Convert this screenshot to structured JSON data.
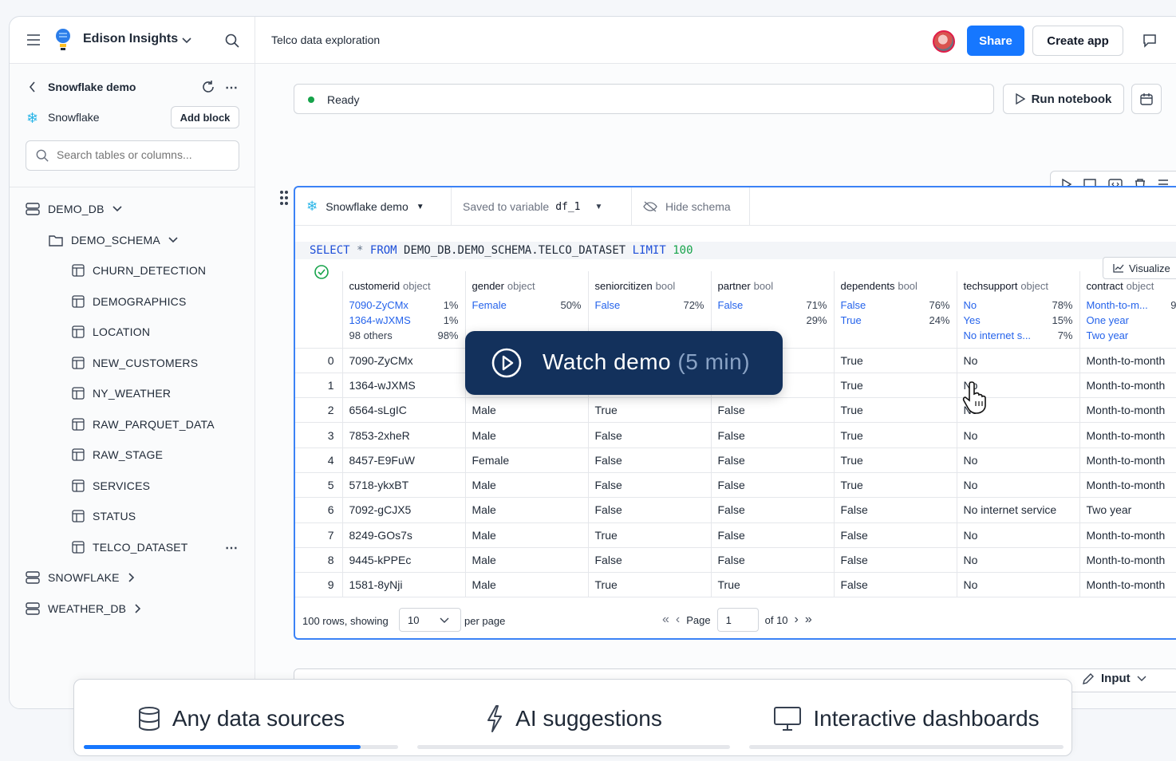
{
  "topbar": {
    "brand": "Edison Insights",
    "doc_title": "Telco data exploration",
    "share": "Share",
    "create_app": "Create app"
  },
  "sidebar": {
    "title": "Snowflake demo",
    "connection": "Snowflake",
    "add_block": "Add block",
    "search_placeholder": "Search tables or columns...",
    "databases": [
      "DEMO_DB",
      "SNOWFLAKE",
      "WEATHER_DB"
    ],
    "schema": "DEMO_SCHEMA",
    "tables": [
      "CHURN_DETECTION",
      "DEMOGRAPHICS",
      "LOCATION",
      "NEW_CUSTOMERS",
      "NY_WEATHER",
      "RAW_PARQUET_DATA",
      "RAW_STAGE",
      "SERVICES",
      "STATUS",
      "TELCO_DATASET"
    ]
  },
  "notebook": {
    "status": "Ready",
    "run": "Run notebook"
  },
  "cell": {
    "source": "Snowflake demo",
    "saved_label": "Saved to variable",
    "variable": "df_1",
    "hide_schema": "Hide schema",
    "sql": {
      "k1": "SELECT",
      "star": "*",
      "k2": "FROM",
      "table": "DEMO_DB.DEMO_SCHEMA.TELCO_DATASET",
      "k3": "LIMIT",
      "n": "100"
    },
    "visualize": "Visualize",
    "columns": [
      {
        "name": "customerid",
        "type": "object",
        "stats": [
          [
            "7090-ZyCMx",
            "1%"
          ],
          [
            "1364-wJXMS",
            "1%"
          ],
          [
            "98 others",
            "98%"
          ]
        ]
      },
      {
        "name": "gender",
        "type": "object",
        "stats": [
          [
            "",
            ""
          ],
          [
            "Female",
            "50%"
          ],
          [
            "",
            ""
          ]
        ]
      },
      {
        "name": "seniorcitizen",
        "type": "bool",
        "stats": [
          [
            "",
            ""
          ],
          [
            "False",
            "72%"
          ],
          [
            "",
            ""
          ]
        ]
      },
      {
        "name": "partner",
        "type": "bool",
        "stats": [
          [
            "",
            ""
          ],
          [
            "False",
            "71%"
          ],
          [
            "",
            "29%"
          ]
        ]
      },
      {
        "name": "dependents",
        "type": "bool",
        "stats": [
          [
            "",
            ""
          ],
          [
            "False",
            "76%"
          ],
          [
            "True",
            "24%"
          ]
        ]
      },
      {
        "name": "techsupport",
        "type": "object",
        "stats": [
          [
            "No",
            "78%"
          ],
          [
            "Yes",
            "15%"
          ],
          [
            "No internet s...",
            "7%"
          ]
        ]
      },
      {
        "name": "contract",
        "type": "object",
        "stats": [
          [
            "Month-to-m...",
            "9"
          ],
          [
            "One year",
            ""
          ],
          [
            "Two year",
            ""
          ]
        ]
      }
    ],
    "rows": [
      [
        "0",
        "7090-ZyCMx",
        "",
        "",
        "",
        "True",
        "No",
        "Month-to-month"
      ],
      [
        "1",
        "1364-wJXMS",
        "",
        "",
        "",
        "True",
        "No",
        "Month-to-month"
      ],
      [
        "2",
        "6564-sLgIC",
        "Male",
        "True",
        "False",
        "True",
        "No",
        "Month-to-month"
      ],
      [
        "3",
        "7853-2xheR",
        "Male",
        "False",
        "False",
        "True",
        "No",
        "Month-to-month"
      ],
      [
        "4",
        "8457-E9FuW",
        "Female",
        "False",
        "False",
        "True",
        "No",
        "Month-to-month"
      ],
      [
        "5",
        "5718-ykxBT",
        "Male",
        "False",
        "False",
        "True",
        "No",
        "Month-to-month"
      ],
      [
        "6",
        "7092-gCJX5",
        "Male",
        "False",
        "False",
        "False",
        "No internet service",
        "Two year"
      ],
      [
        "7",
        "8249-GOs7s",
        "Male",
        "True",
        "False",
        "False",
        "No",
        "Month-to-month"
      ],
      [
        "8",
        "9445-kPPEc",
        "Male",
        "False",
        "False",
        "False",
        "No",
        "Month-to-month"
      ],
      [
        "9",
        "1581-8yNji",
        "Male",
        "True",
        "True",
        "False",
        "No",
        "Month-to-month"
      ]
    ],
    "footer": {
      "rows_text": "100 rows, showing",
      "per_page_value": "10",
      "per_page": "per page",
      "page": "Page",
      "page_value": "1",
      "of": "of 10"
    }
  },
  "input_button": "Input",
  "watch_demo": {
    "label": "Watch demo",
    "duration": "(5 min)"
  },
  "feature_tabs": [
    {
      "label": "Any data sources",
      "progress": 0.88
    },
    {
      "label": "AI suggestions",
      "progress": 0
    },
    {
      "label": "Interactive dashboards",
      "progress": 0
    }
  ],
  "colors": {
    "accent": "#1677ff",
    "banner": "#13315c",
    "ready": "#16a34a"
  }
}
